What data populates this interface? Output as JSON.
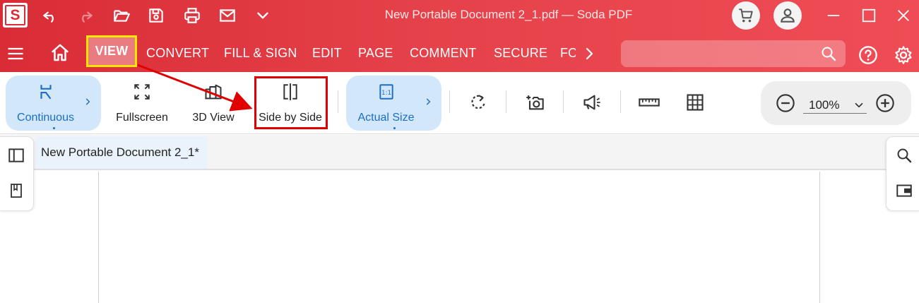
{
  "window": {
    "title": "New Portable Document 2_1.pdf  —  Soda PDF",
    "logo_letter": "S"
  },
  "quick_access": [
    {
      "name": "undo-icon"
    },
    {
      "name": "redo-icon"
    },
    {
      "name": "open-folder-icon"
    },
    {
      "name": "save-icon"
    },
    {
      "name": "print-icon"
    },
    {
      "name": "email-icon"
    },
    {
      "name": "chevron-down-icon"
    }
  ],
  "menu": {
    "items": [
      "VIEW",
      "CONVERT",
      "FILL & SIGN",
      "EDIT",
      "PAGE",
      "COMMENT",
      "SECURE",
      "FO"
    ],
    "active": "VIEW"
  },
  "search": {
    "placeholder": "",
    "value": ""
  },
  "ribbon": {
    "continuous": "Continuous",
    "fullscreen": "Fullscreen",
    "view3d": "3D View",
    "side_by_side": "Side by Side",
    "actual_size": "Actual Size",
    "actual_size_icon_text": "1:1"
  },
  "zoom": {
    "value": "100%"
  },
  "document": {
    "tab_title": "New Portable Document 2_1*"
  },
  "colors": {
    "accent_red": "#d92c36",
    "highlight_yellow": "#f7e600",
    "annotation_red": "#e00000",
    "selected_blue": "#1a6fc4"
  }
}
